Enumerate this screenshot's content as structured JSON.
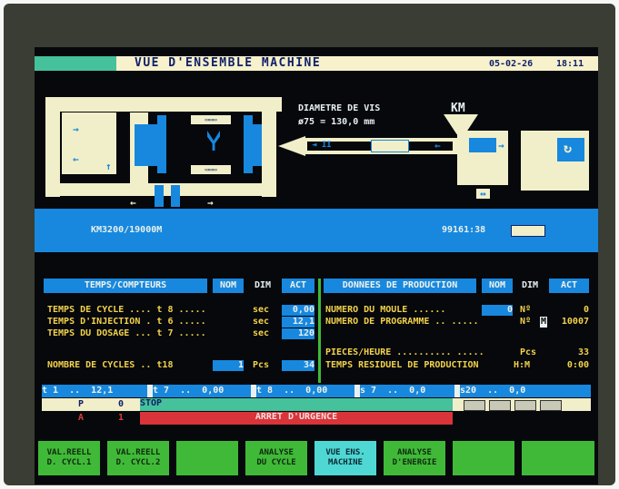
{
  "header": {
    "title": "VUE D'ENSEMBLE MACHINE",
    "date": "05-02-26",
    "time": "18:11"
  },
  "diagram": {
    "screw_label": "DIAMETRE DE VIS",
    "screw_value": "ø75 = 130,0 mm",
    "km_label": "KM",
    "machine_model": "KM3200/19000M",
    "counter_value": "99161:38"
  },
  "times": {
    "title": "TEMPS/COMPTEURS",
    "col_nom": "NOM",
    "col_dim": "DIM",
    "col_act": "ACT",
    "rows": [
      {
        "label": "TEMPS DE CYCLE .... t 8 .....",
        "dim": "sec",
        "act": "0,00"
      },
      {
        "label": "TEMPS D'INJECTION . t 6 .....",
        "dim": "sec",
        "act": "12,1"
      },
      {
        "label": "TEMPS DU DOSAGE ... t 7 .....",
        "dim": "sec",
        "act": "120"
      }
    ],
    "cycles": {
      "label": "NOMBRE DE CYCLES .. t18",
      "nom": "1",
      "dim": "Pcs",
      "act": "34"
    }
  },
  "production": {
    "title": "DONNEES DE PRODUCTION",
    "col_nom": "NOM",
    "col_dim": "DIM",
    "col_act": "ACT",
    "rows": [
      {
        "label": "NUMERO DU MOULE ......",
        "nom": "0",
        "dim": "Nº",
        "act": "0"
      },
      {
        "label": "NUMERO DE PROGRAMME .. .....",
        "dim": "Nº",
        "mark": "M",
        "act": "10007"
      }
    ],
    "pieces": {
      "label": "PIECES/HEURE .......... .....",
      "dim": "Pcs",
      "act": "33"
    },
    "residual": {
      "label": "TEMPS RESIDUEL DE PRODUCTION",
      "dim": "H:M",
      "act": "0:00"
    }
  },
  "status_bar": {
    "seg1": "t 1  ..  12,1",
    "seg2": "t 7  ..  0,00",
    "seg3": "t 8  ..  0,00",
    "seg4": "s 7  ..  0,0",
    "seg5": "s20  ..  0,0"
  },
  "mode_row": {
    "p_label": "P",
    "p_value": "0",
    "stop_text": "STOP"
  },
  "alarm_row": {
    "a_label": "A",
    "a_value": "1",
    "text": "ARRET D'URGENCE"
  },
  "function_keys": [
    {
      "line1": "VAL.REELL",
      "line2": "D. CYCL.1"
    },
    {
      "line1": "VAL.REELL",
      "line2": "D. CYCL.2"
    },
    {
      "line1": "",
      "line2": ""
    },
    {
      "line1": "ANALYSE",
      "line2": "DU CYCLE"
    },
    {
      "line1": "VUE ENS.",
      "line2": "MACHINE"
    },
    {
      "line1": "ANALYSE",
      "line2": "D'ENERGIE"
    },
    {
      "line1": "",
      "line2": ""
    },
    {
      "line1": "",
      "line2": ""
    }
  ],
  "colors": {
    "accent_blue": "#1788de",
    "title_yellow": "#f3d24a",
    "alarm_red": "#d8343a",
    "key_green": "#40b938",
    "active_cyan": "#4fd7d4"
  }
}
